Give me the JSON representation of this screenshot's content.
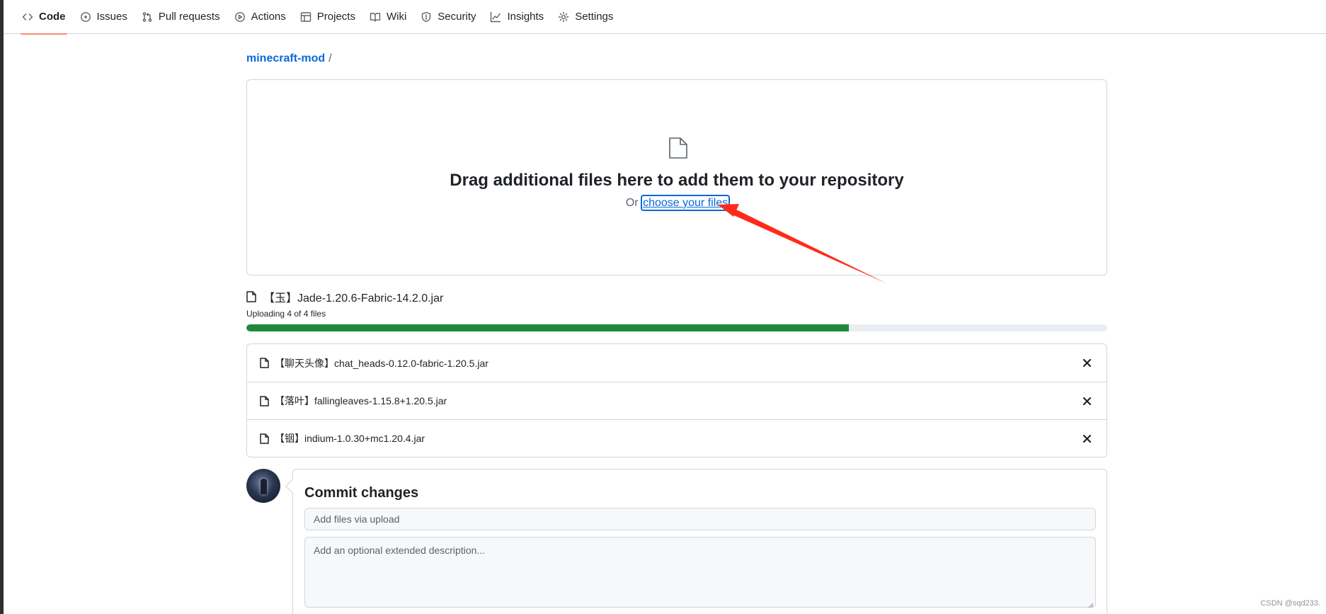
{
  "nav": {
    "tabs": [
      {
        "label": "Code",
        "icon": "code-icon",
        "active": true
      },
      {
        "label": "Issues",
        "icon": "issue-icon",
        "active": false
      },
      {
        "label": "Pull requests",
        "icon": "pull-request-icon",
        "active": false
      },
      {
        "label": "Actions",
        "icon": "play-icon",
        "active": false
      },
      {
        "label": "Projects",
        "icon": "table-icon",
        "active": false
      },
      {
        "label": "Wiki",
        "icon": "book-icon",
        "active": false
      },
      {
        "label": "Security",
        "icon": "shield-icon",
        "active": false
      },
      {
        "label": "Insights",
        "icon": "graph-icon",
        "active": false
      },
      {
        "label": "Settings",
        "icon": "gear-icon",
        "active": false
      }
    ]
  },
  "breadcrumb": {
    "repo": "minecraft-mod",
    "separator": "/"
  },
  "dropzone": {
    "icon": "file-icon",
    "heading": "Drag additional files here to add them to your repository",
    "or_text": "Or",
    "choose_link": "choose your files"
  },
  "upload": {
    "current_file": "【玉】Jade-1.20.6-Fabric-14.2.0.jar",
    "status": "Uploading 4 of 4 files",
    "progress_fraction": 0.7
  },
  "files": [
    {
      "name": "【聊天头像】chat_heads-0.12.0-fabric-1.20.5.jar"
    },
    {
      "name": "【落叶】fallingleaves-1.15.8+1.20.5.jar"
    },
    {
      "name": "【铟】indium-1.0.30+mc1.20.4.jar"
    }
  ],
  "commit": {
    "title": "Commit changes",
    "summary_placeholder": "Add files via upload",
    "description_placeholder": "Add an optional extended description..."
  },
  "watermark": "CSDN @sqd233.",
  "colors": {
    "accent": "#0969da",
    "progress": "#1f883d",
    "active_tab": "#fd8c73",
    "annotation_arrow": "#ff2a1a"
  }
}
